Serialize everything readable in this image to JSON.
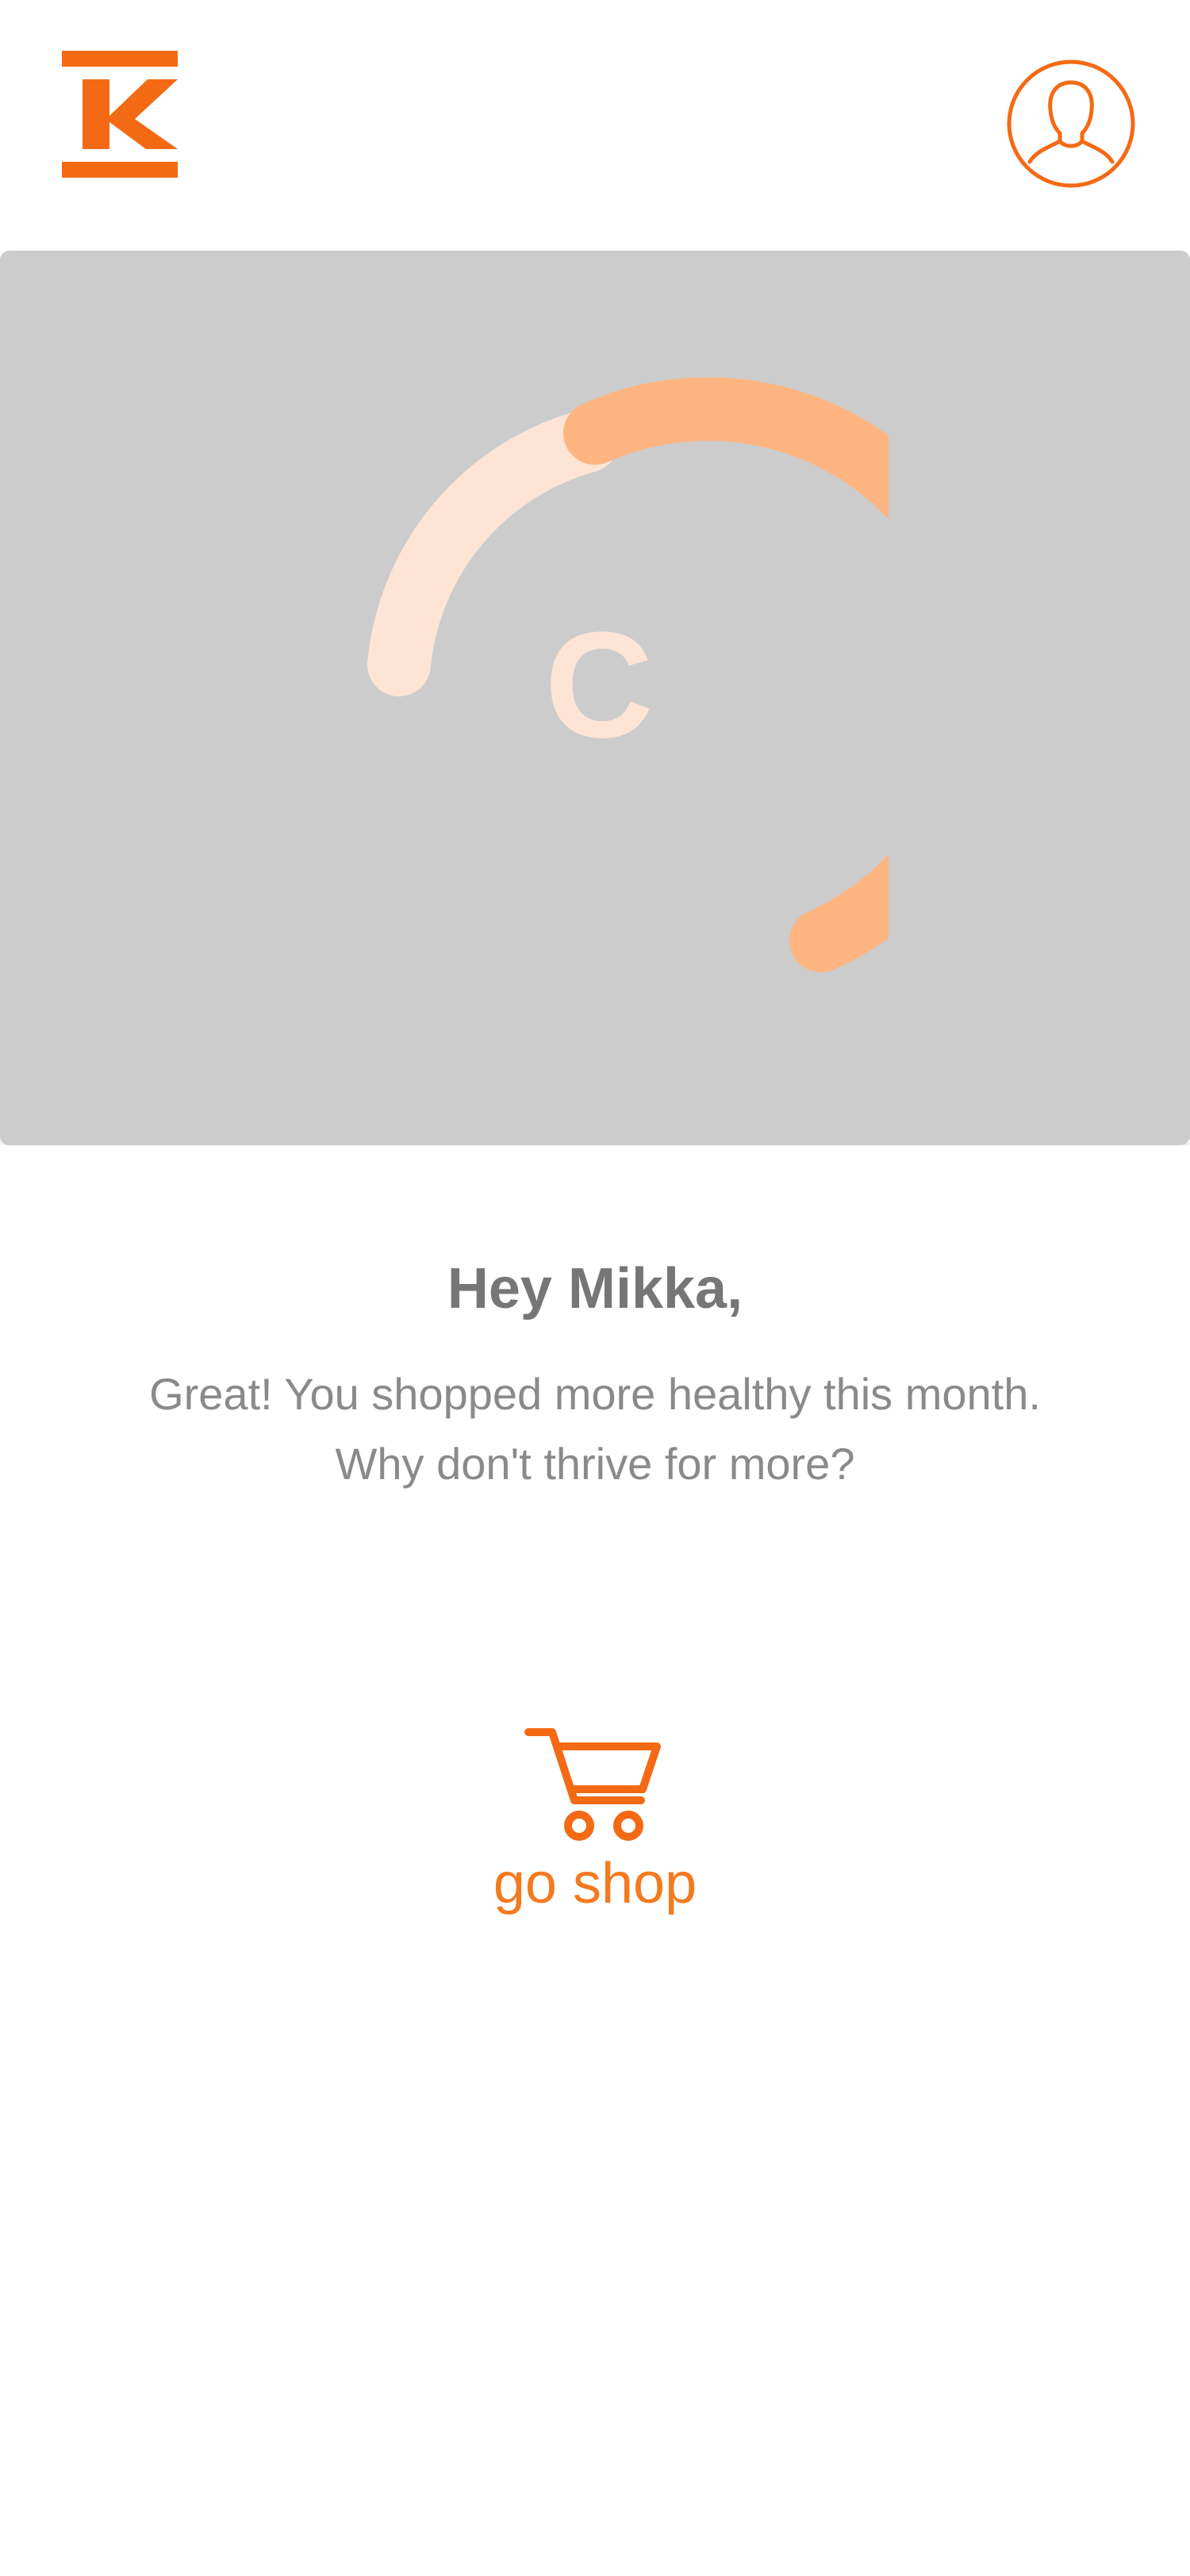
{
  "header": {
    "logo_icon": "k-logo-icon",
    "profile_icon": "user-avatar-icon"
  },
  "hero": {
    "grade_letter": "C",
    "ring_icon": "score-ring"
  },
  "main": {
    "greeting": "Hey Mikka,",
    "message_line1": "Great! You shopped more healthy this month.",
    "message_line2": "Why don't thrive for more?"
  },
  "shop": {
    "icon": "cart-icon",
    "label": "go shop"
  },
  "colors": {
    "accent": "#f46a14",
    "ring_light": "#fde4d5",
    "ring_dark": "#ffb581",
    "card_bg": "#cccccc",
    "text_gray": "#767676"
  }
}
